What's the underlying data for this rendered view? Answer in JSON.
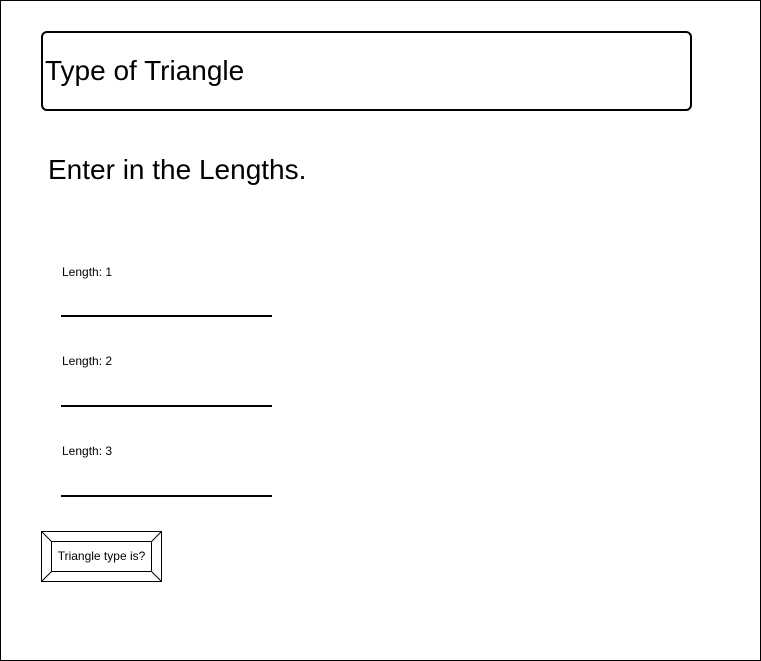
{
  "header": {
    "title": "Type of Triangle"
  },
  "instructions": "Enter in the Lengths.",
  "fields": [
    {
      "label": "Length: 1",
      "value": ""
    },
    {
      "label": "Length: 2",
      "value": ""
    },
    {
      "label": "Length: 3",
      "value": ""
    }
  ],
  "action_button": {
    "label": "Triangle type is?"
  }
}
